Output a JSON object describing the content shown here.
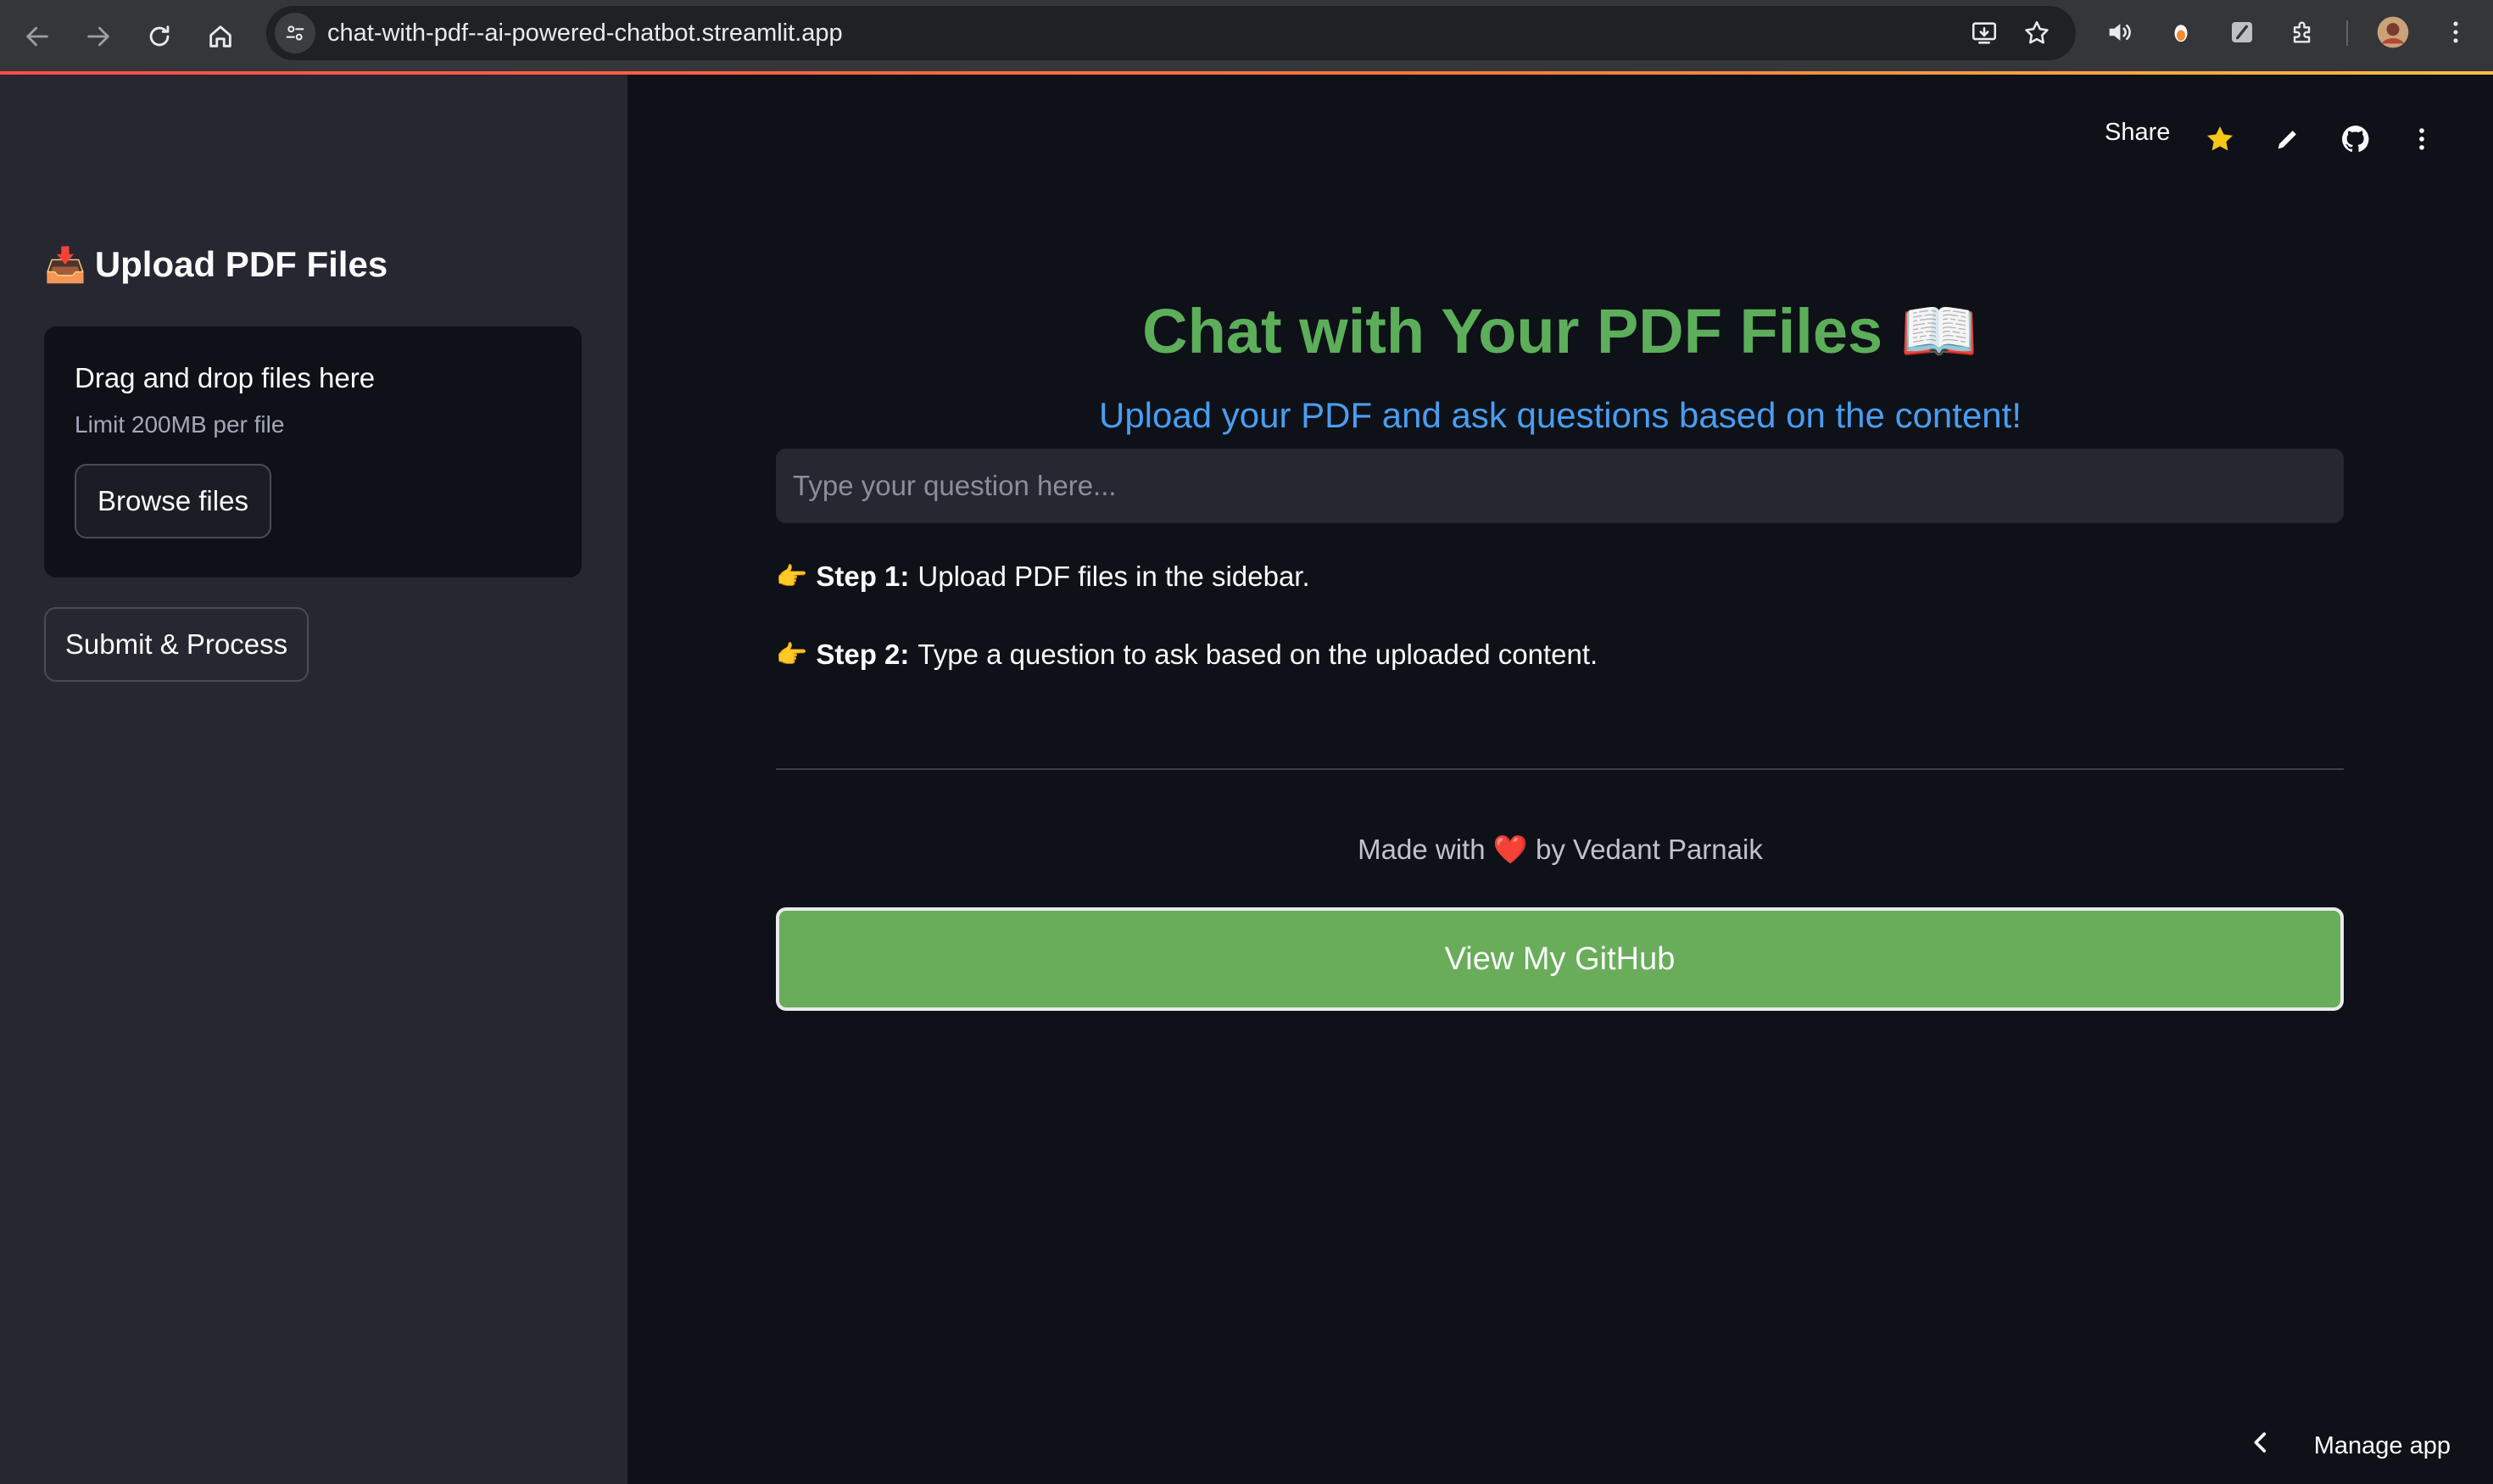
{
  "browser": {
    "url": "chat-with-pdf--ai-powered-chatbot.streamlit.app",
    "nav_icons": [
      "back-arrow-icon",
      "forward-arrow-icon",
      "reload-icon",
      "home-icon"
    ]
  },
  "sidebar": {
    "title_icon": "📥",
    "title": "Upload PDF Files",
    "dropzone_text": "Drag and drop files here",
    "dropzone_limit": "Limit 200MB per file",
    "browse_label": "Browse files",
    "submit_label": "Submit & Process"
  },
  "toolbar": {
    "share_label": "Share"
  },
  "main": {
    "title": "Chat with Your PDF Files",
    "title_icon": "📖",
    "subtitle": "Upload your PDF and ask questions based on the content!",
    "question_placeholder": "Type your question here...",
    "steps": [
      {
        "icon": "👉",
        "label": "Step 1:",
        "text": "Upload PDF files in the sidebar."
      },
      {
        "icon": "👉",
        "label": "Step 2:",
        "text": "Type a question to ask based on the uploaded content."
      }
    ],
    "footer_prefix": "Made with",
    "footer_heart": "❤️",
    "footer_suffix": "by Vedant Parnaik",
    "github_label": "View My GitHub"
  },
  "manage_app": {
    "label": "Manage app"
  },
  "colors": {
    "title_green": "#5cae5a",
    "subtitle_blue": "#4a9df0",
    "button_green": "#69ad5b",
    "sidebar_bg": "#262730",
    "main_bg": "#0e1117",
    "star_yellow": "#f5c518"
  }
}
